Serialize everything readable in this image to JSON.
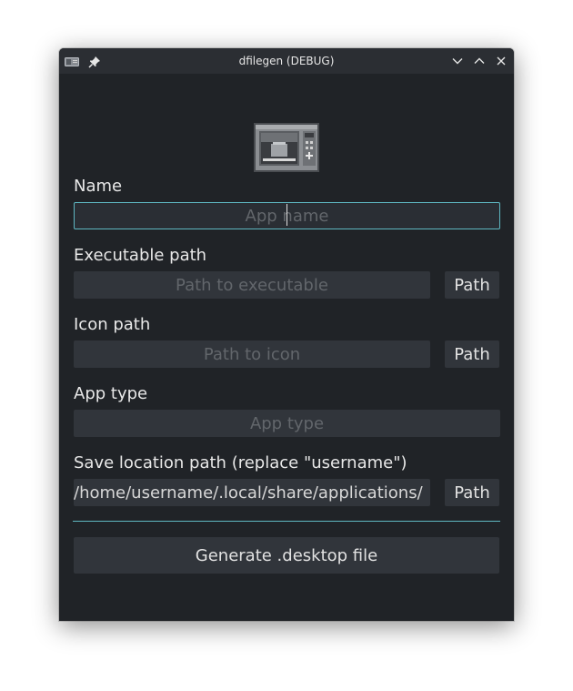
{
  "window": {
    "title": "dfilegen (DEBUG)"
  },
  "titlebar": {
    "app_menu_icon": "window-menu-icon",
    "pin_icon": "pin-icon",
    "minimize_icon": "chevron-down-icon",
    "maximize_icon": "chevron-up-icon",
    "close_icon": "close-icon"
  },
  "app_icon": "microwave-icon",
  "form": {
    "name": {
      "label": "Name",
      "placeholder": "App name",
      "value": ""
    },
    "exec": {
      "label": "Executable path",
      "placeholder": "Path to executable",
      "value": "",
      "button": "Path"
    },
    "icon": {
      "label": "Icon path",
      "placeholder": "Path to icon",
      "value": "",
      "button": "Path"
    },
    "type": {
      "label": "App type",
      "placeholder": "App type",
      "value": ""
    },
    "save": {
      "label": "Save location path (replace \"username\")",
      "value": "/home/username/.local/share/applications/",
      "button": "Path"
    }
  },
  "generate_button": "Generate .desktop file",
  "colors": {
    "window_bg": "#202327",
    "field_bg": "#31353b",
    "accent": "#5fb8c2",
    "text": "#e8e8e8",
    "placeholder": "#62666b"
  }
}
